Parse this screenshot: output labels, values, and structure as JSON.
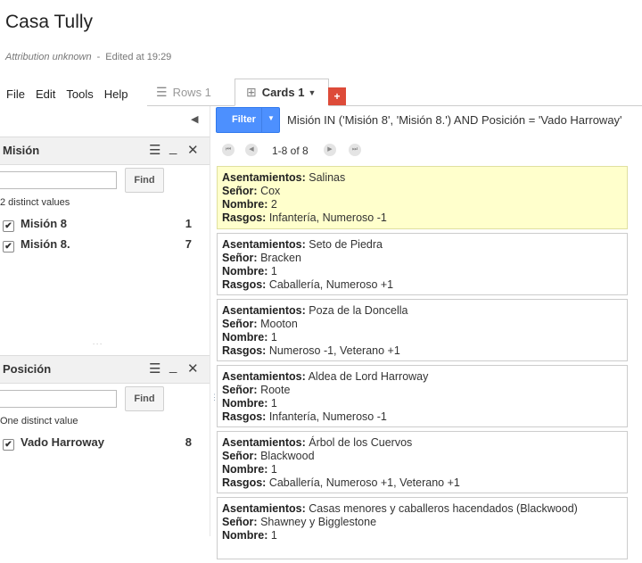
{
  "doc": {
    "title": "Casa Tully",
    "attribution": "Attribution unknown",
    "separator": "-",
    "edited": "Edited at 19:29"
  },
  "menu": [
    "File",
    "Edit",
    "Tools",
    "Help"
  ],
  "tabs": {
    "rows": "Rows 1",
    "cards": "Cards 1",
    "add": "+"
  },
  "filter": {
    "button": "Filter",
    "query": "Misión IN ('Misión 8', 'Misión 8.') AND Posición = 'Vado Harroway'"
  },
  "pager": {
    "text": "1-8 of 8"
  },
  "facets": [
    {
      "title": "Misión",
      "find": "Find",
      "distinct": "2 distinct values",
      "items": [
        {
          "label": "Misión 8",
          "count": "1"
        },
        {
          "label": "Misión 8.",
          "count": "7"
        }
      ]
    },
    {
      "title": "Posición",
      "find": "Find",
      "distinct": "One distinct value",
      "items": [
        {
          "label": "Vado Harroway",
          "count": "8"
        }
      ]
    }
  ],
  "field_labels": {
    "asentamientos": "Asentamientos:",
    "senor": "Señor:",
    "nombre": "Nombre:",
    "rasgos": "Rasgos:"
  },
  "cards": [
    {
      "asentamientos": "Salinas",
      "senor": "Cox",
      "nombre": "2",
      "rasgos": "Infantería, Numeroso -1"
    },
    {
      "asentamientos": "Seto de Piedra",
      "senor": "Bracken",
      "nombre": "1",
      "rasgos": "Caballería, Numeroso +1"
    },
    {
      "asentamientos": "Poza de la Doncella",
      "senor": "Mooton",
      "nombre": "1",
      "rasgos": "Numeroso -1, Veterano +1"
    },
    {
      "asentamientos": "Aldea de Lord Harroway",
      "senor": "Roote",
      "nombre": "1",
      "rasgos": "Infantería, Numeroso -1"
    },
    {
      "asentamientos": "Árbol de los Cuervos",
      "senor": "Blackwood",
      "nombre": "1",
      "rasgos": "Caballería, Numeroso +1, Veterano +1"
    },
    {
      "asentamientos": "Casas menores y caballeros hacendados (Blackwood)",
      "senor": "Shawney y Bigglestone",
      "nombre": "1",
      "rasgos": ""
    }
  ],
  "colors": {
    "filter_button": "#4d90fe",
    "highlight_card": "#ffffcc",
    "add_tab": "#dd4b39"
  }
}
